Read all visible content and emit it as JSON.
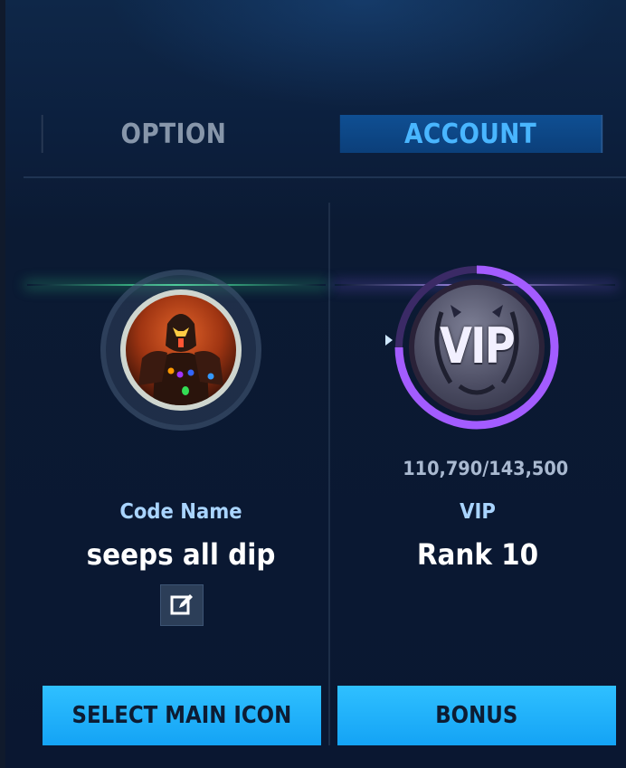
{
  "tabs": [
    {
      "label": "OPTION",
      "active": false
    },
    {
      "label": "ACCOUNT",
      "active": true
    }
  ],
  "profile": {
    "code_name_label": "Code Name",
    "code_name": "seeps all dip",
    "select_button": "SELECT MAIN ICON"
  },
  "vip": {
    "badge_text": "VIP",
    "progress_text": "110,790/143,500",
    "current": 110790,
    "target": 143500,
    "label": "VIP",
    "rank": "Rank 10",
    "bonus_button": "BONUS"
  },
  "colors": {
    "accent_blue": "#14a3f5",
    "active_tab_text": "#49b6ff",
    "vip_ring": "#a35cff",
    "profile_glow": "#50ffaa"
  }
}
